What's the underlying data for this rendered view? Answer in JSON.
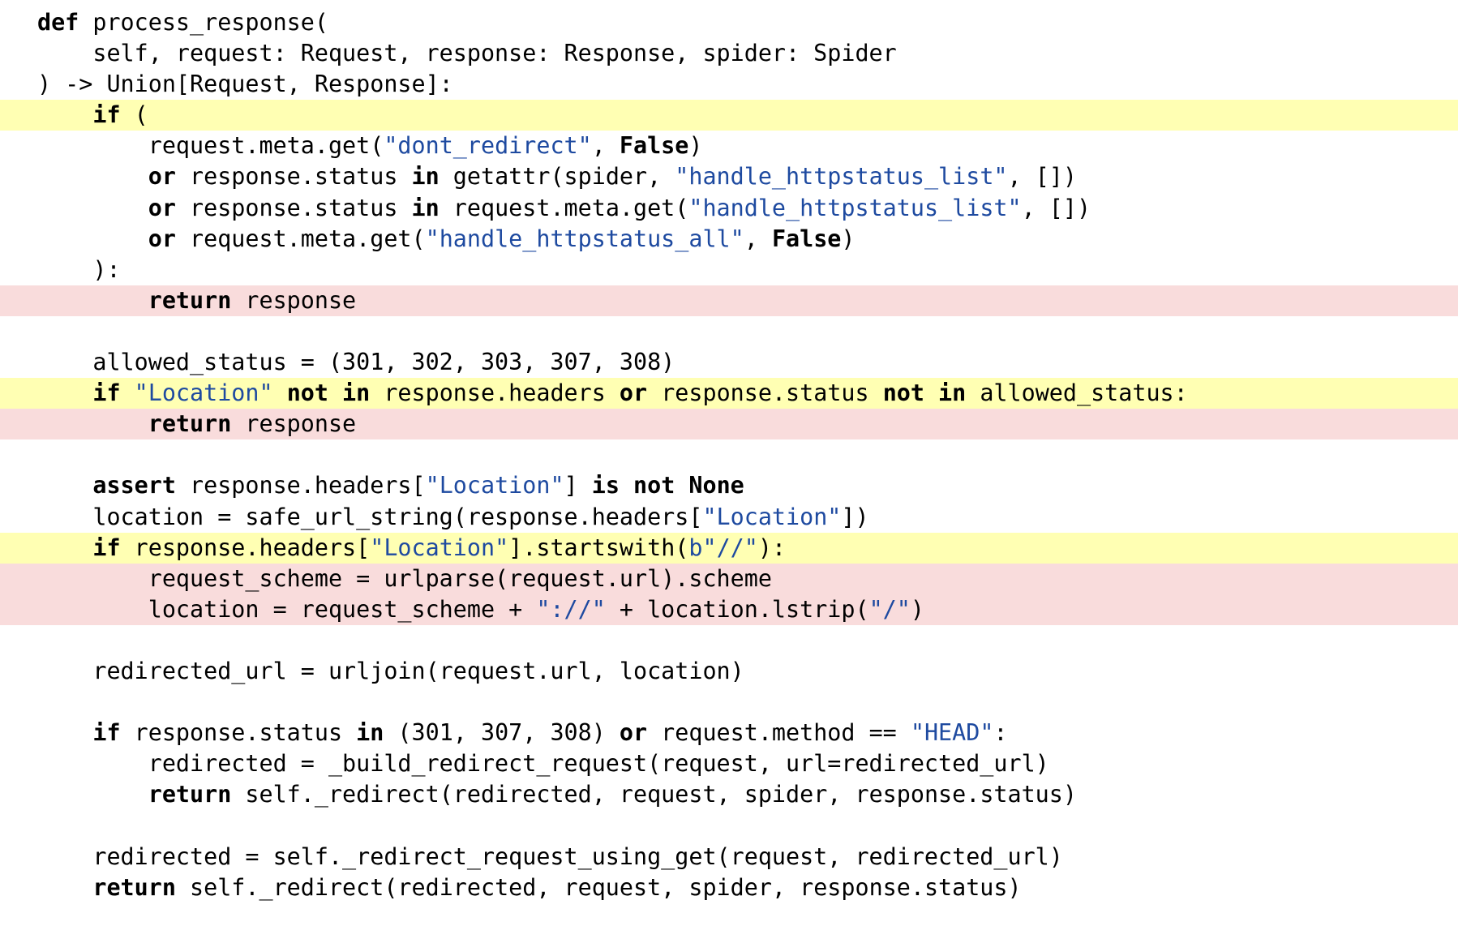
{
  "colors": {
    "highlight_yellow": "#ffffb3",
    "highlight_red": "#f9dcdc",
    "string": "#1e4aa0",
    "text": "#000000",
    "background": "#ffffff"
  },
  "lines": [
    {
      "highlight": "none",
      "tokens": [
        {
          "k": "kw",
          "t": "def"
        },
        {
          "k": "t",
          "t": " process_response("
        }
      ]
    },
    {
      "highlight": "none",
      "tokens": [
        {
          "k": "t",
          "t": "    self, request: Request, response: Response, spider: Spider"
        }
      ]
    },
    {
      "highlight": "none",
      "tokens": [
        {
          "k": "t",
          "t": ") -> Union[Request, Response]:"
        }
      ]
    },
    {
      "highlight": "yellow",
      "tokens": [
        {
          "k": "t",
          "t": "    "
        },
        {
          "k": "kw",
          "t": "if"
        },
        {
          "k": "t",
          "t": " ("
        }
      ]
    },
    {
      "highlight": "none",
      "tokens": [
        {
          "k": "t",
          "t": "        request.meta.get("
        },
        {
          "k": "str",
          "t": "\"dont_redirect\""
        },
        {
          "k": "t",
          "t": ", "
        },
        {
          "k": "kw",
          "t": "False"
        },
        {
          "k": "t",
          "t": ")"
        }
      ]
    },
    {
      "highlight": "none",
      "tokens": [
        {
          "k": "t",
          "t": "        "
        },
        {
          "k": "kw",
          "t": "or"
        },
        {
          "k": "t",
          "t": " response.status "
        },
        {
          "k": "kw",
          "t": "in"
        },
        {
          "k": "t",
          "t": " getattr(spider, "
        },
        {
          "k": "str",
          "t": "\"handle_httpstatus_list\""
        },
        {
          "k": "t",
          "t": ", [])"
        }
      ]
    },
    {
      "highlight": "none",
      "tokens": [
        {
          "k": "t",
          "t": "        "
        },
        {
          "k": "kw",
          "t": "or"
        },
        {
          "k": "t",
          "t": " response.status "
        },
        {
          "k": "kw",
          "t": "in"
        },
        {
          "k": "t",
          "t": " request.meta.get("
        },
        {
          "k": "str",
          "t": "\"handle_httpstatus_list\""
        },
        {
          "k": "t",
          "t": ", [])"
        }
      ]
    },
    {
      "highlight": "none",
      "tokens": [
        {
          "k": "t",
          "t": "        "
        },
        {
          "k": "kw",
          "t": "or"
        },
        {
          "k": "t",
          "t": " request.meta.get("
        },
        {
          "k": "str",
          "t": "\"handle_httpstatus_all\""
        },
        {
          "k": "t",
          "t": ", "
        },
        {
          "k": "kw",
          "t": "False"
        },
        {
          "k": "t",
          "t": ")"
        }
      ]
    },
    {
      "highlight": "none",
      "tokens": [
        {
          "k": "t",
          "t": "    ):"
        }
      ]
    },
    {
      "highlight": "red",
      "tokens": [
        {
          "k": "t",
          "t": "        "
        },
        {
          "k": "kw",
          "t": "return"
        },
        {
          "k": "t",
          "t": " response"
        }
      ]
    },
    {
      "highlight": "none",
      "tokens": []
    },
    {
      "highlight": "none",
      "tokens": [
        {
          "k": "t",
          "t": "    allowed_status = (301, 302, 303, 307, 308)"
        }
      ]
    },
    {
      "highlight": "yellow",
      "tokens": [
        {
          "k": "t",
          "t": "    "
        },
        {
          "k": "kw",
          "t": "if"
        },
        {
          "k": "t",
          "t": " "
        },
        {
          "k": "str",
          "t": "\"Location\""
        },
        {
          "k": "t",
          "t": " "
        },
        {
          "k": "kw",
          "t": "not in"
        },
        {
          "k": "t",
          "t": " response.headers "
        },
        {
          "k": "kw",
          "t": "or"
        },
        {
          "k": "t",
          "t": " response.status "
        },
        {
          "k": "kw",
          "t": "not in"
        },
        {
          "k": "t",
          "t": " allowed_status:"
        }
      ]
    },
    {
      "highlight": "red",
      "tokens": [
        {
          "k": "t",
          "t": "        "
        },
        {
          "k": "kw",
          "t": "return"
        },
        {
          "k": "t",
          "t": " response"
        }
      ]
    },
    {
      "highlight": "none",
      "tokens": []
    },
    {
      "highlight": "none",
      "tokens": [
        {
          "k": "t",
          "t": "    "
        },
        {
          "k": "kw",
          "t": "assert"
        },
        {
          "k": "t",
          "t": " response.headers["
        },
        {
          "k": "str",
          "t": "\"Location\""
        },
        {
          "k": "t",
          "t": "] "
        },
        {
          "k": "kw",
          "t": "is not None"
        }
      ]
    },
    {
      "highlight": "none",
      "tokens": [
        {
          "k": "t",
          "t": "    location = safe_url_string(response.headers["
        },
        {
          "k": "str",
          "t": "\"Location\""
        },
        {
          "k": "t",
          "t": "])"
        }
      ]
    },
    {
      "highlight": "yellow",
      "tokens": [
        {
          "k": "t",
          "t": "    "
        },
        {
          "k": "kw",
          "t": "if"
        },
        {
          "k": "t",
          "t": " response.headers["
        },
        {
          "k": "str",
          "t": "\"Location\""
        },
        {
          "k": "t",
          "t": "].startswith("
        },
        {
          "k": "str",
          "t": "b\"//\""
        },
        {
          "k": "t",
          "t": "):"
        }
      ]
    },
    {
      "highlight": "red",
      "tokens": [
        {
          "k": "t",
          "t": "        request_scheme = urlparse(request.url).scheme"
        }
      ]
    },
    {
      "highlight": "red",
      "tokens": [
        {
          "k": "t",
          "t": "        location = request_scheme + "
        },
        {
          "k": "str",
          "t": "\"://\""
        },
        {
          "k": "t",
          "t": " + location.lstrip("
        },
        {
          "k": "str",
          "t": "\"/\""
        },
        {
          "k": "t",
          "t": ")"
        }
      ]
    },
    {
      "highlight": "none",
      "tokens": []
    },
    {
      "highlight": "none",
      "tokens": [
        {
          "k": "t",
          "t": "    redirected_url = urljoin(request.url, location)"
        }
      ]
    },
    {
      "highlight": "none",
      "tokens": []
    },
    {
      "highlight": "none",
      "tokens": [
        {
          "k": "t",
          "t": "    "
        },
        {
          "k": "kw",
          "t": "if"
        },
        {
          "k": "t",
          "t": " response.status "
        },
        {
          "k": "kw",
          "t": "in"
        },
        {
          "k": "t",
          "t": " (301, 307, 308) "
        },
        {
          "k": "kw",
          "t": "or"
        },
        {
          "k": "t",
          "t": " request.method == "
        },
        {
          "k": "str",
          "t": "\"HEAD\""
        },
        {
          "k": "t",
          "t": ":"
        }
      ]
    },
    {
      "highlight": "none",
      "tokens": [
        {
          "k": "t",
          "t": "        redirected = _build_redirect_request(request, url=redirected_url)"
        }
      ]
    },
    {
      "highlight": "none",
      "tokens": [
        {
          "k": "t",
          "t": "        "
        },
        {
          "k": "kw",
          "t": "return"
        },
        {
          "k": "t",
          "t": " self._redirect(redirected, request, spider, response.status)"
        }
      ]
    },
    {
      "highlight": "none",
      "tokens": []
    },
    {
      "highlight": "none",
      "tokens": [
        {
          "k": "t",
          "t": "    redirected = self._redirect_request_using_get(request, redirected_url)"
        }
      ]
    },
    {
      "highlight": "none",
      "tokens": [
        {
          "k": "t",
          "t": "    "
        },
        {
          "k": "kw",
          "t": "return"
        },
        {
          "k": "t",
          "t": " self._redirect(redirected, request, spider, response.status)"
        }
      ]
    }
  ]
}
